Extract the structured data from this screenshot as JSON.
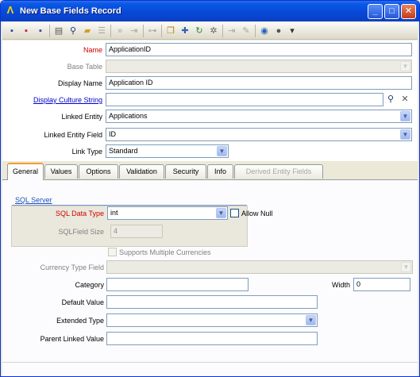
{
  "window": {
    "title": "New Base Fields Record",
    "minimize": "_",
    "maximize": "□",
    "close": "✕",
    "app_icon": "Λ"
  },
  "toolbar": {
    "icons": [
      "save-icon",
      "save-close-icon",
      "save-new-icon",
      "print-icon",
      "find-icon",
      "open-icon",
      "list-icon",
      "next-icon",
      "last-icon",
      "link-icon",
      "copy-icon",
      "new-icon",
      "refresh-icon",
      "settings-icon",
      "move-icon",
      "edit-icon",
      "help-icon",
      "info-icon",
      "menu-icon"
    ]
  },
  "form": {
    "name_label": "Name",
    "name_value": "ApplicationID",
    "base_table_label": "Base Table",
    "base_table_value": "",
    "display_name_label": "Display Name",
    "display_name_value": "Application ID",
    "display_culture_label": "Display Culture String",
    "display_culture_value": "",
    "linked_entity_label": "Linked Entity",
    "linked_entity_value": "Applications",
    "linked_entity_field_label": "Linked Entity Field",
    "linked_entity_field_value": "ID",
    "link_type_label": "Link Type",
    "link_type_value": "Standard"
  },
  "tabs": [
    {
      "label": "General",
      "active": true,
      "enabled": true
    },
    {
      "label": "Values",
      "active": false,
      "enabled": true
    },
    {
      "label": "Options",
      "active": false,
      "enabled": true
    },
    {
      "label": "Validation",
      "active": false,
      "enabled": true
    },
    {
      "label": "Security",
      "active": false,
      "enabled": true
    },
    {
      "label": "Info",
      "active": false,
      "enabled": true
    },
    {
      "label": "Derived Entity Fields",
      "active": false,
      "enabled": false
    }
  ],
  "general": {
    "group_title": "SQL Server",
    "sql_data_type_label": "SQL Data Type",
    "sql_data_type_value": "int",
    "allow_null_label": "Allow Null",
    "sql_field_size_label": "SQLField Size",
    "sql_field_size_value": "4",
    "supports_currencies_label": "Supports Multiple Currencies",
    "currency_type_label": "Currency Type Field",
    "currency_type_value": "",
    "category_label": "Category",
    "category_value": "",
    "width_label": "Width",
    "width_value": "0",
    "default_value_label": "Default Value",
    "default_value_value": "",
    "extended_type_label": "Extended Type",
    "extended_type_value": "",
    "parent_linked_label": "Parent Linked Value",
    "parent_linked_value": ""
  },
  "colors": {
    "title_bar": "#0747d5",
    "required_label": "#d00000",
    "link_label": "#0000cc",
    "tab_accent": "#f0a030"
  }
}
